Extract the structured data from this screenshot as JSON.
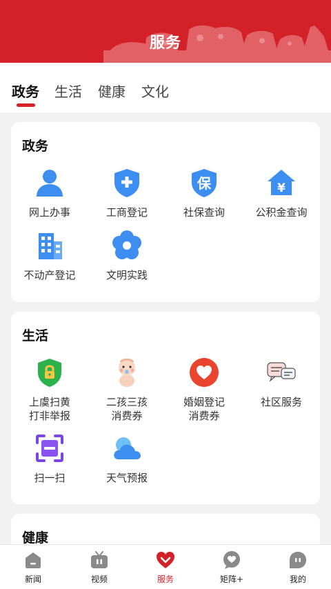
{
  "header": {
    "title": "服务"
  },
  "tabs": [
    {
      "label": "政务",
      "active": true
    },
    {
      "label": "生活",
      "active": false
    },
    {
      "label": "健康",
      "active": false
    },
    {
      "label": "文化",
      "active": false
    }
  ],
  "sections": {
    "gov": {
      "title": "政务",
      "items": [
        {
          "label": "网上办事",
          "icon": "user-icon"
        },
        {
          "label": "工商登记",
          "icon": "shield-plus-icon"
        },
        {
          "label": "社保查询",
          "icon": "social-security-icon",
          "glyph": "保"
        },
        {
          "label": "公积金查询",
          "icon": "housing-fund-icon",
          "glyph": "¥"
        },
        {
          "label": "不动产登记",
          "icon": "building-icon"
        },
        {
          "label": "文明实践",
          "icon": "flower-icon"
        }
      ]
    },
    "life": {
      "title": "生活",
      "items": [
        {
          "label": "上虞扫黄\n打非举报",
          "icon": "lock-shield-icon"
        },
        {
          "label": "二孩三孩\n消费券",
          "icon": "baby-icon"
        },
        {
          "label": "婚姻登记\n消费券",
          "icon": "heart-icon"
        },
        {
          "label": "社区服务",
          "icon": "chat-bubbles-icon"
        },
        {
          "label": "扫一扫",
          "icon": "scan-icon"
        },
        {
          "label": "天气预报",
          "icon": "cloud-icon"
        }
      ]
    },
    "health": {
      "title": "健康"
    }
  },
  "bottom_nav": [
    {
      "label": "新闻",
      "icon": "home-icon",
      "active": false
    },
    {
      "label": "视频",
      "icon": "tv-icon",
      "active": false
    },
    {
      "label": "服务",
      "icon": "heart-service-icon",
      "active": true
    },
    {
      "label": "矩阵+",
      "icon": "matrix-bubble-icon",
      "active": false
    },
    {
      "label": "我的",
      "icon": "profile-icon",
      "active": false
    }
  ],
  "colors": {
    "brand_red": "#d42027",
    "icon_blue": "#3d8ef0",
    "nav_gray": "#8a8a8a"
  }
}
